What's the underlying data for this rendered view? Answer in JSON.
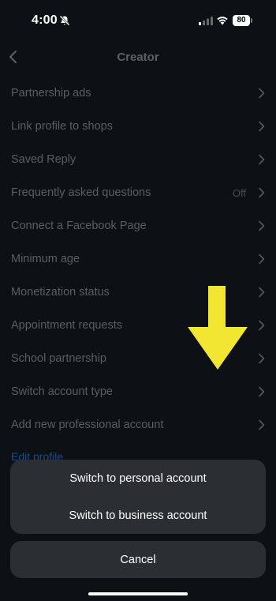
{
  "status_bar": {
    "time": "4:00",
    "battery": "80"
  },
  "header": {
    "title": "Creator",
    "back_icon": "chevron-left-icon"
  },
  "settings": {
    "items": [
      {
        "label": "Partnership ads",
        "value": ""
      },
      {
        "label": "Link profile to shops",
        "value": ""
      },
      {
        "label": "Saved Reply",
        "value": ""
      },
      {
        "label": "Frequently asked questions",
        "value": "Off"
      },
      {
        "label": "Connect a Facebook Page",
        "value": ""
      },
      {
        "label": "Minimum age",
        "value": ""
      },
      {
        "label": "Monetization status",
        "value": ""
      },
      {
        "label": "Appointment requests",
        "value": ""
      },
      {
        "label": "School partnership",
        "value": ""
      },
      {
        "label": "Switch account type",
        "value": ""
      },
      {
        "label": "Add new professional account",
        "value": ""
      }
    ],
    "edit_profile": "Edit profile"
  },
  "action_sheet": {
    "option_personal": "Switch to personal account",
    "option_business": "Switch to business account",
    "cancel": "Cancel"
  },
  "colors": {
    "background": "#0d1014",
    "sheet": "#2b2e33",
    "arrow": "#f2e633",
    "link": "#1a4b8e"
  }
}
